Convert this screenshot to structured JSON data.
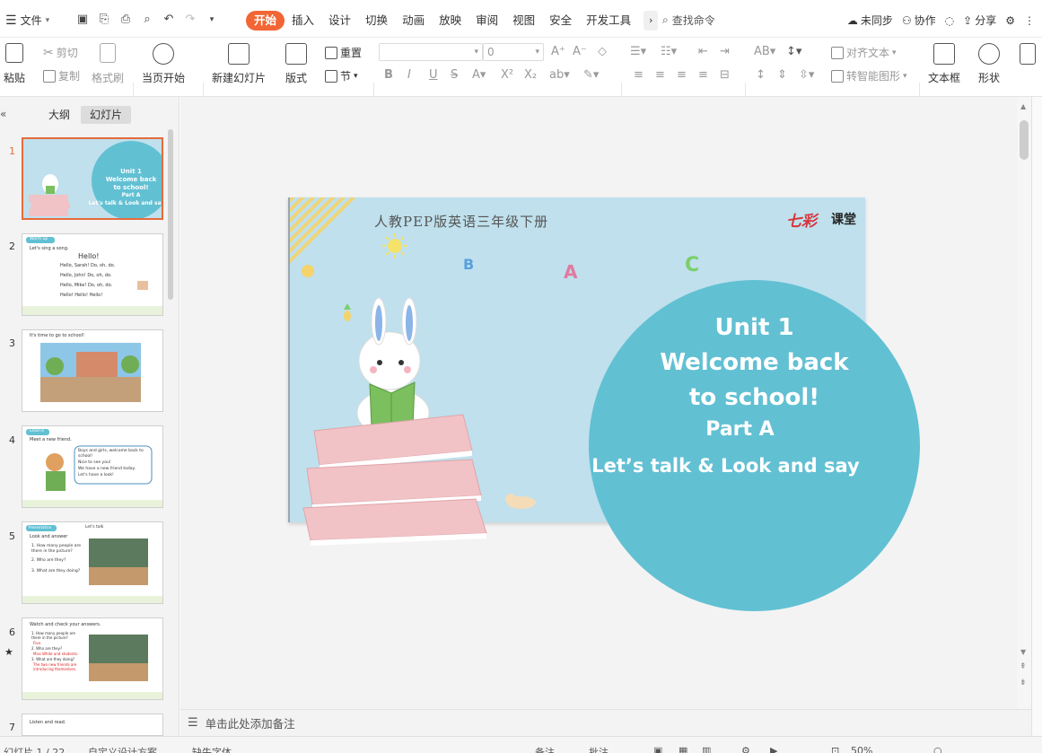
{
  "menu": {
    "file": "文件"
  },
  "tabs": [
    "开始",
    "插入",
    "设计",
    "切换",
    "动画",
    "放映",
    "审阅",
    "视图",
    "安全",
    "开发工具"
  ],
  "search_label": "查找命令",
  "topright": {
    "sync": "未同步",
    "collab": "协作",
    "share": "分享"
  },
  "ribbon": {
    "paste": "粘贴",
    "cut": "剪切",
    "copy": "复制",
    "format_painter": "格式刷",
    "play_from_current": "当页开始",
    "new_slide": "新建幻灯片",
    "layout": "版式",
    "reset": "重置",
    "section": "节",
    "font_size": "0",
    "align_text": "对齐文本",
    "smart_graphic": "转智能图形",
    "textbox": "文本框",
    "shape": "形状"
  },
  "panel": {
    "tab_outline": "大纲",
    "tab_slides": "幻灯片"
  },
  "slides": [
    {
      "num": "1"
    },
    {
      "num": "2"
    },
    {
      "num": "3"
    },
    {
      "num": "4"
    },
    {
      "num": "5"
    },
    {
      "num": "6"
    },
    {
      "num": "7"
    }
  ],
  "thumbs": {
    "s2": {
      "tag": "Warm up",
      "title": "Let's sing a song.",
      "hello": "Hello!",
      "l1": "Hello, Sarah! Do, oh, do.",
      "l2": "Hello, John! Do, oh, do.",
      "l3": "Hello, Mike! Do, oh, do.",
      "l4": "Hello! Hello! Hello!"
    },
    "s3": {
      "title": "It's time to go to school!"
    },
    "s4": {
      "tag": "Lead in",
      "title": "Meet a new friend.",
      "b1": "Boys and girls, welcome back to school!",
      "b2": "Nice to see you!",
      "b3": "We have a new friend today.",
      "b4": "Let's have a look!"
    },
    "s5": {
      "tag": "Presentation",
      "sub": "Let's talk",
      "title": "Look and answer",
      "q1": "1. How many people are there in the picture?",
      "q2": "2. Who are they?",
      "q3": "3. What are they doing?"
    },
    "s6": {
      "title": "Watch and check your answers.",
      "q1": "1. How many people are there in the picture?",
      "a1": "Five.",
      "q2": "2. Who are they?",
      "a2": "Miss White and students.",
      "q3": "3. What are they doing?",
      "a3": "The two new friends are introducing themselves."
    },
    "s7": {
      "title": "Listen and read."
    }
  },
  "main_slide": {
    "header": "人教PEP版英语三年级下册",
    "brand_a": "七彩",
    "brand_b": "课堂",
    "line1": "Unit 1",
    "line2": "Welcome back",
    "line3": "to school!",
    "line4": "Part A",
    "line5": "Let’s talk & Look and say",
    "letters": [
      "B",
      "A",
      "C"
    ],
    "colors": {
      "bg": "#bfe0ec",
      "circle": "#62c0d3",
      "book": "#f2c3c6"
    }
  },
  "notes_placeholder": "单击此处添加备注",
  "status": {
    "page": "幻灯片 1 / 22",
    "theme": "自定义设计方案",
    "font": "缺失字体",
    "notes": "备注",
    "comments": "批注",
    "zoom": "50%"
  }
}
